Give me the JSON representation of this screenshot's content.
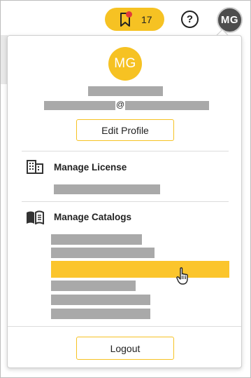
{
  "topbar": {
    "bookmark_count": "17",
    "help_label": "?",
    "user_initials": "MG"
  },
  "profile": {
    "initials": "MG",
    "email_separator": "@",
    "edit_profile_label": "Edit Profile"
  },
  "sections": {
    "license_title": "Manage License",
    "catalogs_title": "Manage Catalogs"
  },
  "catalogs": {
    "item_count": 6,
    "selected_index": 2
  },
  "footer": {
    "logout_label": "Logout"
  },
  "colors": {
    "accent": "#f6c223",
    "notification": "#e03a3a",
    "avatar_dark": "#4d4d4d",
    "redacted": "#a9a9a9"
  },
  "icons": {
    "bookmark": "bookmark-icon",
    "help": "help-circle-icon",
    "license": "building-icon",
    "catalogs": "open-book-icon",
    "cursor": "hand-pointer-icon"
  }
}
